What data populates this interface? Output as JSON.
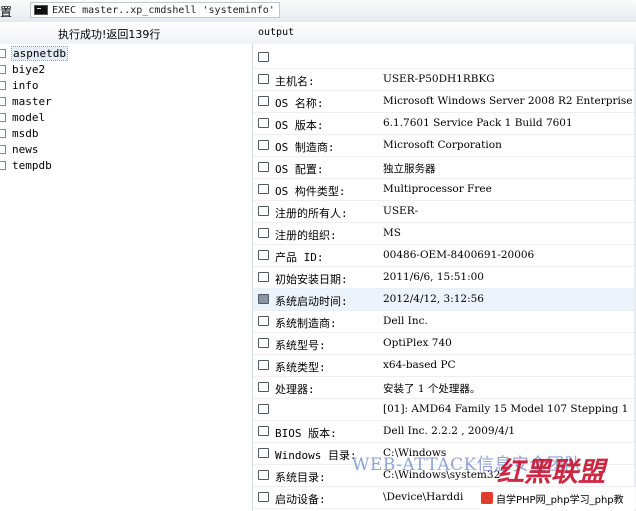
{
  "toolbar": {
    "settings_label": "置",
    "command": "EXEC master..xp_cmdshell 'systeminfo'"
  },
  "status": {
    "message": "执行成功!返回139行",
    "output_header": "output"
  },
  "databases": [
    {
      "name": "aspnetdb",
      "selected": true
    },
    {
      "name": "biye2"
    },
    {
      "name": "info"
    },
    {
      "name": "master"
    },
    {
      "name": "model"
    },
    {
      "name": "msdb"
    },
    {
      "name": "news"
    },
    {
      "name": "tempdb"
    }
  ],
  "output_rows": [
    {
      "label": "",
      "value": ""
    },
    {
      "label": "主机名:",
      "value": "USER-P50DH1RBKG"
    },
    {
      "label": "OS 名称:",
      "value": "Microsoft Windows Server 2008 R2 Enterprise"
    },
    {
      "label": "OS 版本:",
      "value": "6.1.7601 Service Pack 1 Build 7601"
    },
    {
      "label": "OS 制造商:",
      "value": "Microsoft Corporation"
    },
    {
      "label": "OS 配置:",
      "value": "独立服务器"
    },
    {
      "label": "OS 构件类型:",
      "value": "Multiprocessor Free"
    },
    {
      "label": "注册的所有人:",
      "value": "USER-"
    },
    {
      "label": "注册的组织:",
      "value": "MS"
    },
    {
      "label": "产品 ID:",
      "value": "00486-OEM-8400691-20006"
    },
    {
      "label": "初始安装日期:",
      "value": "2011/6/6, 15:51:00"
    },
    {
      "label": "系统启动时间:",
      "value": "2012/4/12, 3:12:56",
      "highlight": true
    },
    {
      "label": "系统制造商:",
      "value": "Dell Inc."
    },
    {
      "label": "系统型号:",
      "value": "OptiPlex 740"
    },
    {
      "label": "系统类型:",
      "value": "x64-based PC"
    },
    {
      "label": "处理器:",
      "value": "安装了 1 个处理器。"
    },
    {
      "label": "",
      "value": "[01]: AMD64 Family 15 Model 107 Stepping 1"
    },
    {
      "label": "BIOS 版本:",
      "value": "Dell Inc. 2.2.2 , 2009/4/1"
    },
    {
      "label": "Windows 目录:",
      "value": "C:\\Windows"
    },
    {
      "label": "系统目录:",
      "value": "C:\\Windows\\system32"
    },
    {
      "label": "启动设备:",
      "value": "\\Device\\Harddi"
    }
  ],
  "watermark": {
    "text1": "WEB-ATTACK信息安全团队",
    "text2": "红黑联盟",
    "text3": "自学PHP网_php学习_php教"
  }
}
